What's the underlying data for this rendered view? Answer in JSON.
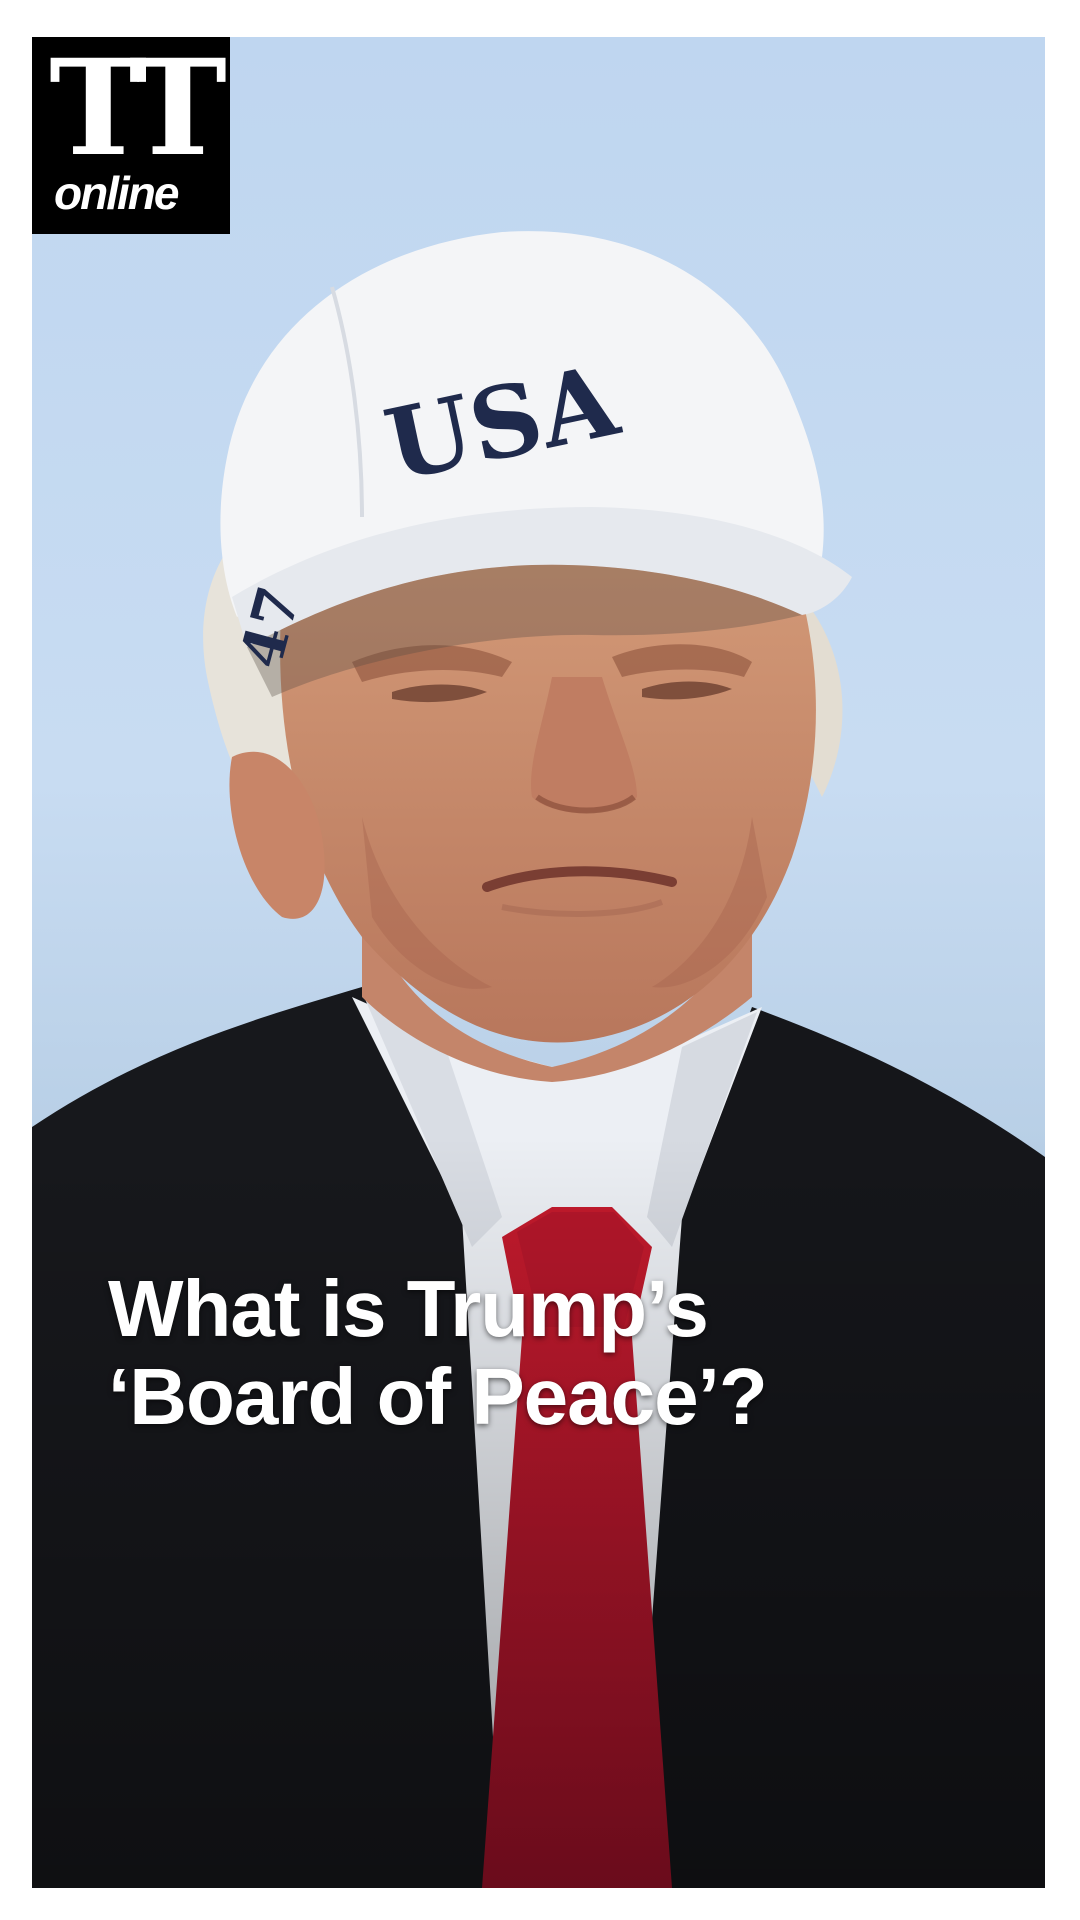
{
  "logo": {
    "mark": "TT",
    "sub": "online"
  },
  "photo": {
    "cap_text": "USA",
    "cap_side_text": "47"
  },
  "headline": {
    "line1": "What is Trump’s",
    "line2": "‘Board of Peace’?"
  }
}
